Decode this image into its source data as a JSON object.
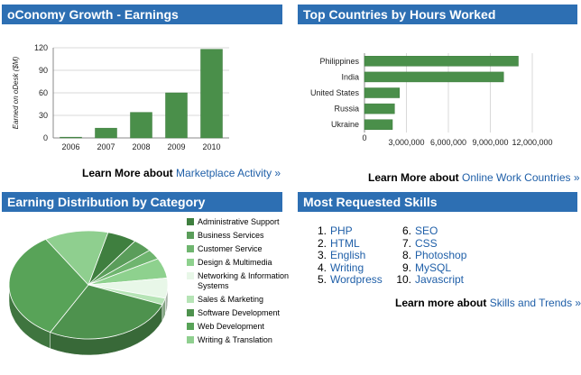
{
  "panels": {
    "growth": {
      "title": "oConomy Growth - Earnings",
      "learn_prefix": "Learn More about",
      "learn_link": "Marketplace Activity »"
    },
    "countries": {
      "title": "Top Countries by Hours Worked",
      "learn_prefix": "Learn More about",
      "learn_link": "Online Work Countries »"
    },
    "category": {
      "title": "Earning Distribution by Category"
    },
    "skills": {
      "title": "Most Requested Skills",
      "learn_prefix": "Learn more about",
      "learn_link": "Skills and Trends »",
      "items": [
        {
          "num": "1.",
          "name": "PHP"
        },
        {
          "num": "2.",
          "name": "HTML"
        },
        {
          "num": "3.",
          "name": "English"
        },
        {
          "num": "4.",
          "name": "Writing"
        },
        {
          "num": "5.",
          "name": "Wordpress"
        },
        {
          "num": "6.",
          "name": "SEO"
        },
        {
          "num": "7.",
          "name": "CSS"
        },
        {
          "num": "8.",
          "name": "Photoshop"
        },
        {
          "num": "9.",
          "name": "MySQL"
        },
        {
          "num": "10.",
          "name": "Javascript"
        }
      ]
    }
  },
  "colors": {
    "header": "#2d6fb3",
    "link": "#1f5fa8",
    "bar": "#4a8f4a"
  },
  "chart_data": [
    {
      "type": "bar",
      "categories": [
        "2006",
        "2007",
        "2008",
        "2009",
        "2010"
      ],
      "values": [
        1,
        13,
        34,
        60,
        118
      ],
      "ylabel": "Earned on oDesk ($M)",
      "ylim": [
        0,
        120
      ],
      "yticks": [
        "0",
        "30",
        "60",
        "90",
        "120"
      ],
      "grid": true
    },
    {
      "type": "bar",
      "orientation": "horizontal",
      "categories": [
        "Philippines",
        "India",
        "United States",
        "Russia",
        "Ukraine"
      ],
      "values": [
        11000000,
        9950000,
        2500000,
        2150000,
        2000000
      ],
      "xlim": [
        0,
        12000000
      ],
      "xticks": [
        "0",
        "3,000,000",
        "6,000,000",
        "9,000,000",
        "12,000,000"
      ],
      "grid": true
    },
    {
      "type": "pie",
      "categories": [
        "Administrative Support",
        "Business Services",
        "Customer Service",
        "Design & Multimedia",
        "Networking & Information Systems",
        "Sales & Marketing",
        "Software Development",
        "Web Development",
        "Writing & Translation"
      ],
      "values": [
        6,
        4,
        3,
        6,
        6,
        2,
        27,
        33,
        13
      ],
      "colors": [
        "#3f7f3f",
        "#5a9d5a",
        "#6fb56f",
        "#8ed18e",
        "#e8f7e8",
        "#b6e4b6",
        "#4e924e",
        "#58a358",
        "#8fcf8f"
      ],
      "legend": "right"
    }
  ]
}
